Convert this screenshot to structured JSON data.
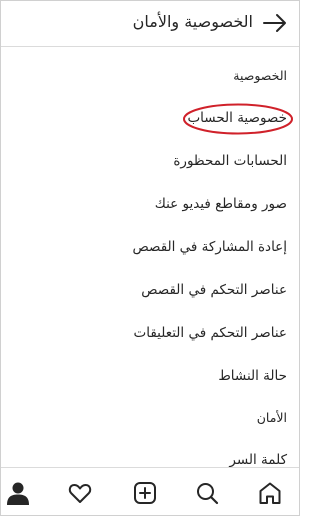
{
  "header": {
    "title": "الخصوصية والأمان"
  },
  "list": [
    {
      "label": "الخصوصية",
      "kind": "section"
    },
    {
      "label": "خصوصية الحساب",
      "kind": "item",
      "highlighted": true
    },
    {
      "label": "الحسابات المحظورة",
      "kind": "item"
    },
    {
      "label": "صور ومقاطع فيديو عنك",
      "kind": "item"
    },
    {
      "label": "إعادة المشاركة في القصص",
      "kind": "item"
    },
    {
      "label": "عناصر التحكم في القصص",
      "kind": "item"
    },
    {
      "label": "عناصر التحكم في التعليقات",
      "kind": "item"
    },
    {
      "label": "حالة النشاط",
      "kind": "item"
    },
    {
      "label": "الأمان",
      "kind": "section"
    },
    {
      "label": "كلمة السر",
      "kind": "item"
    }
  ],
  "bottom_nav": {
    "icons": [
      "profile-icon",
      "heart-icon",
      "add-post-icon",
      "search-icon",
      "home-icon"
    ],
    "active": "profile-icon"
  },
  "colors": {
    "text": "#262626",
    "divider": "#dbdbdb",
    "highlight_ring": "#d0212a"
  }
}
